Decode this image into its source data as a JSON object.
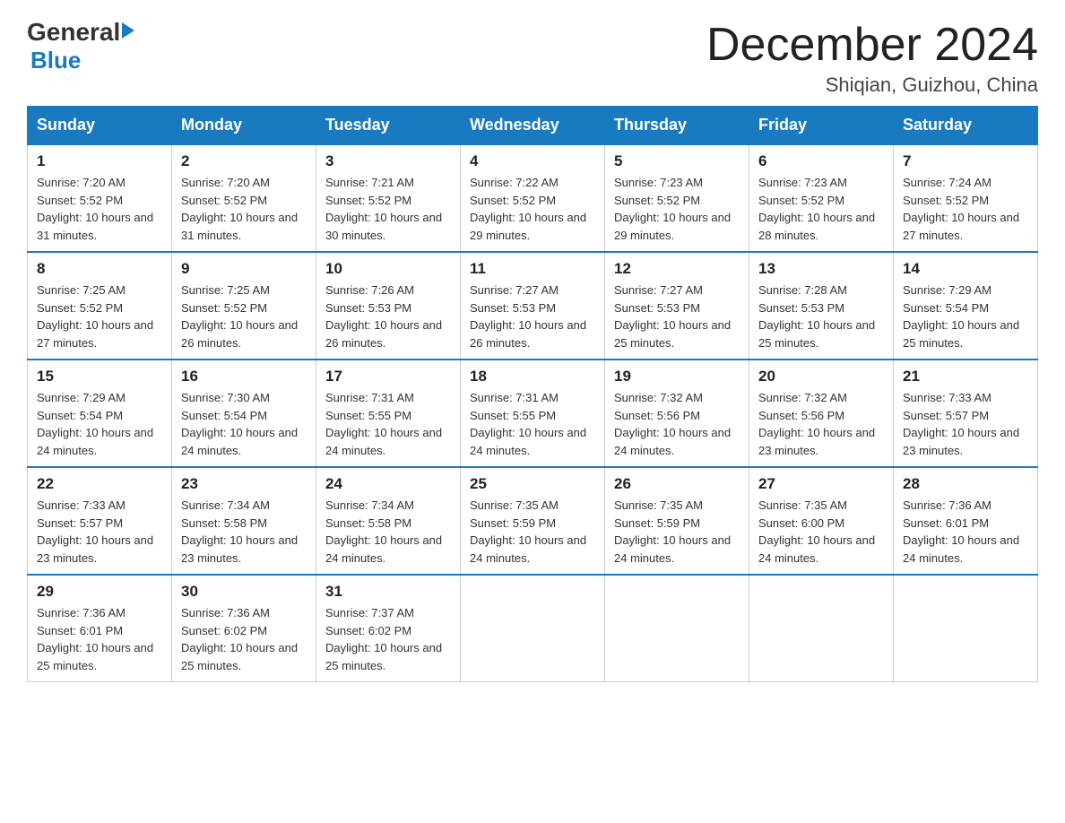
{
  "header": {
    "logo_general": "General",
    "logo_blue": "Blue",
    "month_title": "December 2024",
    "location": "Shiqian, Guizhou, China"
  },
  "days_of_week": [
    "Sunday",
    "Monday",
    "Tuesday",
    "Wednesday",
    "Thursday",
    "Friday",
    "Saturday"
  ],
  "weeks": [
    [
      {
        "day": "1",
        "sunrise": "7:20 AM",
        "sunset": "5:52 PM",
        "daylight": "10 hours and 31 minutes."
      },
      {
        "day": "2",
        "sunrise": "7:20 AM",
        "sunset": "5:52 PM",
        "daylight": "10 hours and 31 minutes."
      },
      {
        "day": "3",
        "sunrise": "7:21 AM",
        "sunset": "5:52 PM",
        "daylight": "10 hours and 30 minutes."
      },
      {
        "day": "4",
        "sunrise": "7:22 AM",
        "sunset": "5:52 PM",
        "daylight": "10 hours and 29 minutes."
      },
      {
        "day": "5",
        "sunrise": "7:23 AM",
        "sunset": "5:52 PM",
        "daylight": "10 hours and 29 minutes."
      },
      {
        "day": "6",
        "sunrise": "7:23 AM",
        "sunset": "5:52 PM",
        "daylight": "10 hours and 28 minutes."
      },
      {
        "day": "7",
        "sunrise": "7:24 AM",
        "sunset": "5:52 PM",
        "daylight": "10 hours and 27 minutes."
      }
    ],
    [
      {
        "day": "8",
        "sunrise": "7:25 AM",
        "sunset": "5:52 PM",
        "daylight": "10 hours and 27 minutes."
      },
      {
        "day": "9",
        "sunrise": "7:25 AM",
        "sunset": "5:52 PM",
        "daylight": "10 hours and 26 minutes."
      },
      {
        "day": "10",
        "sunrise": "7:26 AM",
        "sunset": "5:53 PM",
        "daylight": "10 hours and 26 minutes."
      },
      {
        "day": "11",
        "sunrise": "7:27 AM",
        "sunset": "5:53 PM",
        "daylight": "10 hours and 26 minutes."
      },
      {
        "day": "12",
        "sunrise": "7:27 AM",
        "sunset": "5:53 PM",
        "daylight": "10 hours and 25 minutes."
      },
      {
        "day": "13",
        "sunrise": "7:28 AM",
        "sunset": "5:53 PM",
        "daylight": "10 hours and 25 minutes."
      },
      {
        "day": "14",
        "sunrise": "7:29 AM",
        "sunset": "5:54 PM",
        "daylight": "10 hours and 25 minutes."
      }
    ],
    [
      {
        "day": "15",
        "sunrise": "7:29 AM",
        "sunset": "5:54 PM",
        "daylight": "10 hours and 24 minutes."
      },
      {
        "day": "16",
        "sunrise": "7:30 AM",
        "sunset": "5:54 PM",
        "daylight": "10 hours and 24 minutes."
      },
      {
        "day": "17",
        "sunrise": "7:31 AM",
        "sunset": "5:55 PM",
        "daylight": "10 hours and 24 minutes."
      },
      {
        "day": "18",
        "sunrise": "7:31 AM",
        "sunset": "5:55 PM",
        "daylight": "10 hours and 24 minutes."
      },
      {
        "day": "19",
        "sunrise": "7:32 AM",
        "sunset": "5:56 PM",
        "daylight": "10 hours and 24 minutes."
      },
      {
        "day": "20",
        "sunrise": "7:32 AM",
        "sunset": "5:56 PM",
        "daylight": "10 hours and 23 minutes."
      },
      {
        "day": "21",
        "sunrise": "7:33 AM",
        "sunset": "5:57 PM",
        "daylight": "10 hours and 23 minutes."
      }
    ],
    [
      {
        "day": "22",
        "sunrise": "7:33 AM",
        "sunset": "5:57 PM",
        "daylight": "10 hours and 23 minutes."
      },
      {
        "day": "23",
        "sunrise": "7:34 AM",
        "sunset": "5:58 PM",
        "daylight": "10 hours and 23 minutes."
      },
      {
        "day": "24",
        "sunrise": "7:34 AM",
        "sunset": "5:58 PM",
        "daylight": "10 hours and 24 minutes."
      },
      {
        "day": "25",
        "sunrise": "7:35 AM",
        "sunset": "5:59 PM",
        "daylight": "10 hours and 24 minutes."
      },
      {
        "day": "26",
        "sunrise": "7:35 AM",
        "sunset": "5:59 PM",
        "daylight": "10 hours and 24 minutes."
      },
      {
        "day": "27",
        "sunrise": "7:35 AM",
        "sunset": "6:00 PM",
        "daylight": "10 hours and 24 minutes."
      },
      {
        "day": "28",
        "sunrise": "7:36 AM",
        "sunset": "6:01 PM",
        "daylight": "10 hours and 24 minutes."
      }
    ],
    [
      {
        "day": "29",
        "sunrise": "7:36 AM",
        "sunset": "6:01 PM",
        "daylight": "10 hours and 25 minutes."
      },
      {
        "day": "30",
        "sunrise": "7:36 AM",
        "sunset": "6:02 PM",
        "daylight": "10 hours and 25 minutes."
      },
      {
        "day": "31",
        "sunrise": "7:37 AM",
        "sunset": "6:02 PM",
        "daylight": "10 hours and 25 minutes."
      },
      null,
      null,
      null,
      null
    ]
  ]
}
